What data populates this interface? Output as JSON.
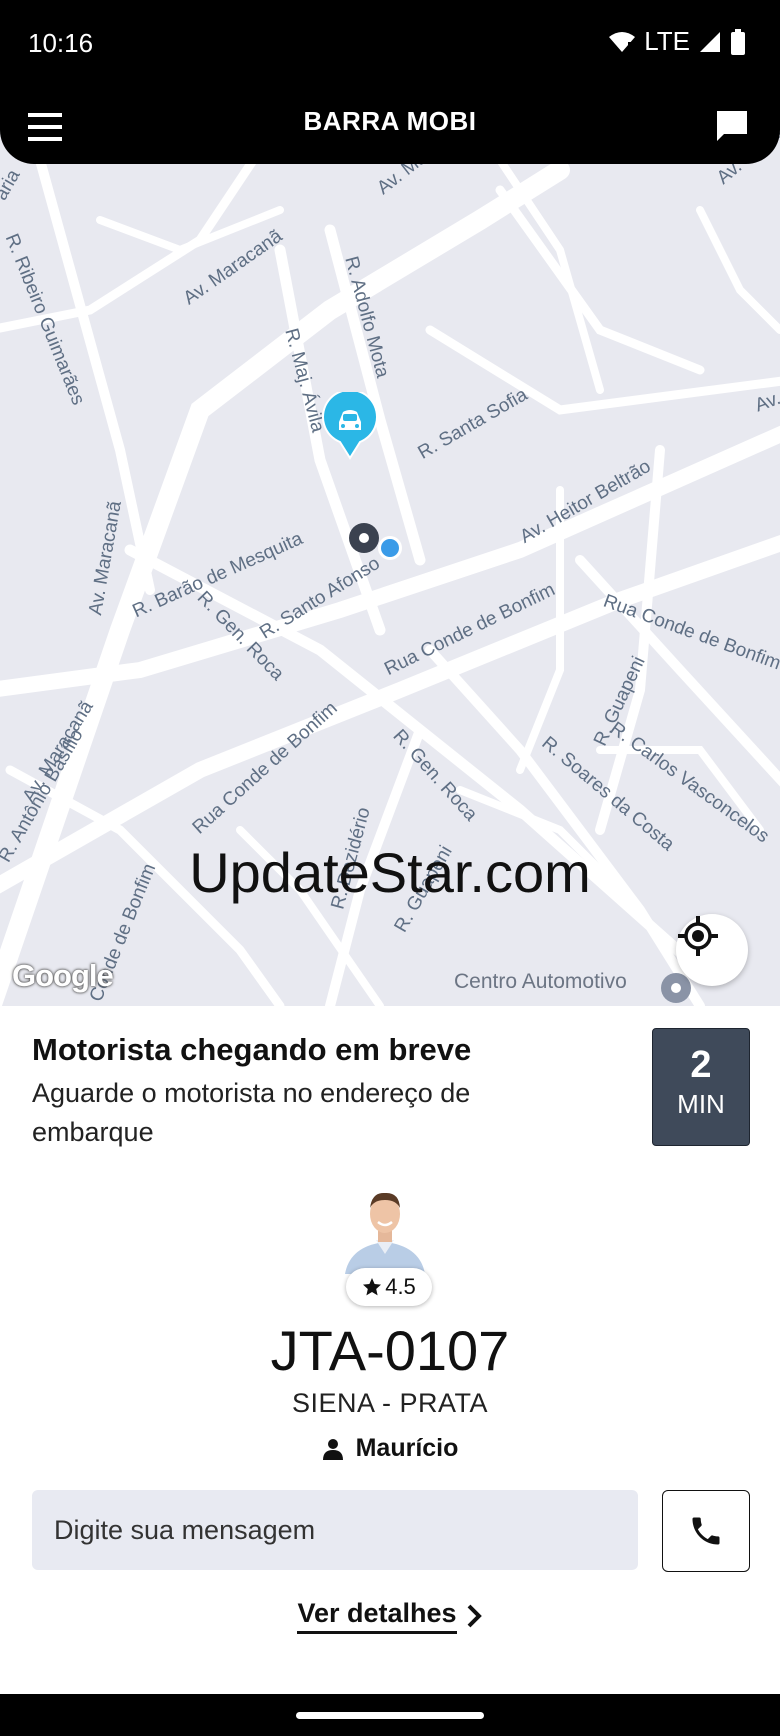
{
  "status": {
    "time": "10:16",
    "network": "LTE"
  },
  "app": {
    "title": "BARRA MOBI"
  },
  "map": {
    "watermark": "UpdateStar.com",
    "google_logo": "Google",
    "poi": "Centro Automotivo",
    "streets": {
      "s1": "Av. Maracanã",
      "s2": "Av. Maracanã",
      "s3": "R. Ribeiro Guimarães",
      "s4": "aria",
      "s5": "R. Adolfo Mota",
      "s6": "R. Maj. Ávila",
      "s7": "R. Santa Sofia",
      "s8": "Av. Heitor Beltrão",
      "s9": "R. Barão de Mesquita",
      "s10": "R. Santo Afonso",
      "s11": "Av. Maracanã",
      "s12": "R. Gen. Roca",
      "s13": "Rua Conde de Bonfim",
      "s14": "Rua Conde de Bonfim",
      "s15": "R. Guapeni",
      "s16": "Rua Conde de Bonfim",
      "s17": "Av. Maracanã",
      "s18": "R. Antônio Basílio",
      "s19": "R. Gen. Roca",
      "s20": "R. Dezidério",
      "s21": "R. Guapeni",
      "s22": "R. Soares da Costa",
      "s23": "R. Carlos Vasconcelos",
      "s24": "Conde de Bonfim",
      "s25": "Av. Maracanã",
      "s26": "Av."
    }
  },
  "trip": {
    "title": "Motorista chegando em breve",
    "subtitle": "Aguarde o motorista no endereço de embarque",
    "eta_value": "2",
    "eta_unit": "MIN",
    "rating": "4.5",
    "plate": "JTA-0107",
    "car": "SIENA - PRATA",
    "driver_name": "Maurício",
    "message_placeholder": "Digite sua mensagem",
    "details_label": "Ver detalhes"
  },
  "icons": {
    "menu": "menu-icon",
    "chat": "chat-icon",
    "locate": "crosshair-icon",
    "car_marker": "car-marker-icon",
    "phone": "phone-icon",
    "person": "person-icon",
    "star": "star-icon",
    "chevron": "chevron-right-icon"
  },
  "colors": {
    "accent": "#2bb7e6",
    "eta_bg": "#3f4a5a",
    "map_bg": "#e8e9f0"
  }
}
